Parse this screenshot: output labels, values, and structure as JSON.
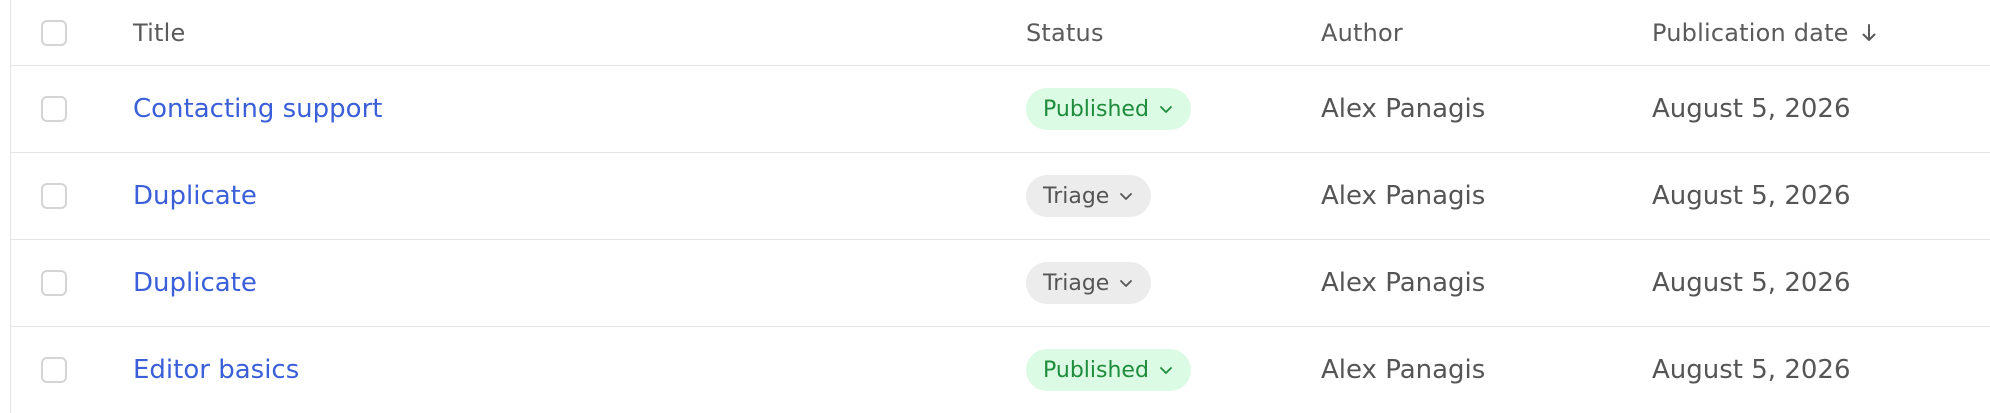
{
  "columns": {
    "title": "Title",
    "status": "Status",
    "author": "Author",
    "date": "Publication date",
    "date_sort": "descending"
  },
  "rows": [
    {
      "title": "Contacting support",
      "status": "Published",
      "status_kind": "published",
      "author": "Alex Panagis",
      "date": "August 5, 2026"
    },
    {
      "title": "Duplicate",
      "status": "Triage",
      "status_kind": "triage",
      "author": "Alex Panagis",
      "date": "August 5, 2026"
    },
    {
      "title": "Duplicate",
      "status": "Triage",
      "status_kind": "triage",
      "author": "Alex Panagis",
      "date": "August 5, 2026"
    },
    {
      "title": "Editor basics",
      "status": "Published",
      "status_kind": "published",
      "author": "Alex Panagis",
      "date": "August 5, 2026"
    }
  ],
  "colors": {
    "link": "#3a5fd9",
    "published_bg": "#dcfbe4",
    "published_text": "#1f8b3c",
    "triage_bg": "#ececec",
    "triage_text": "#555555"
  }
}
